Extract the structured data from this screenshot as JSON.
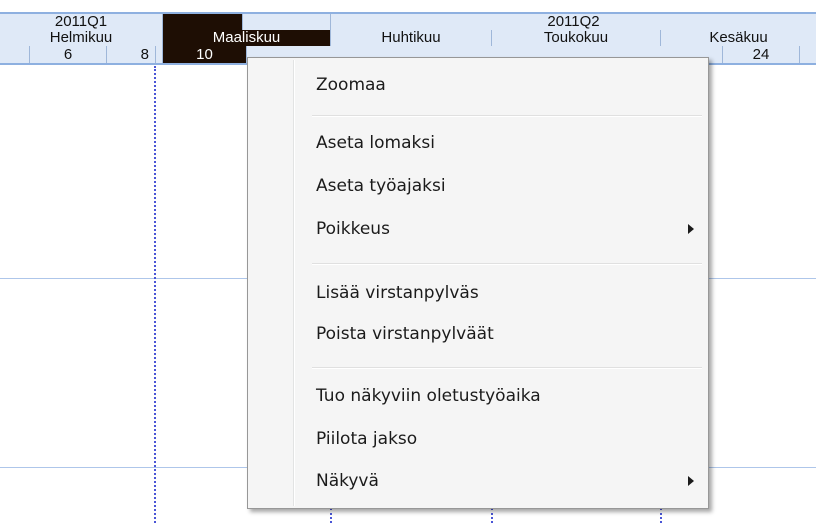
{
  "timeline": {
    "quarters": [
      "2011Q1",
      "2011Q2"
    ],
    "months": [
      "Helmikuu",
      "Maaliskuu",
      "Huhtikuu",
      "Toukokuu",
      "Kesäkuu"
    ],
    "weeks": [
      "6",
      "8",
      "10",
      "24"
    ],
    "selected_month": "Maaliskuu",
    "selected_week": "10"
  },
  "context_menu": {
    "items": [
      {
        "label": "Zoomaa"
      },
      {
        "label": "Aseta lomaksi"
      },
      {
        "label": "Aseta työajaksi"
      },
      {
        "label": "Poikkeus"
      },
      {
        "label": "Lisää virstanpylväs"
      },
      {
        "label": "Poista virstanpylväät"
      },
      {
        "label": "Tuo näkyviin oletustyöaika"
      },
      {
        "label": "Piilota jakso"
      },
      {
        "label": "Näkyvä"
      }
    ]
  },
  "colors": {
    "header_bg": "#dfe9f7",
    "selected_bg": "#1e0e04",
    "grid_line": "#aec6ea",
    "dashed_line": "#4a55d6",
    "menu_bg": "#f5f5f5"
  }
}
